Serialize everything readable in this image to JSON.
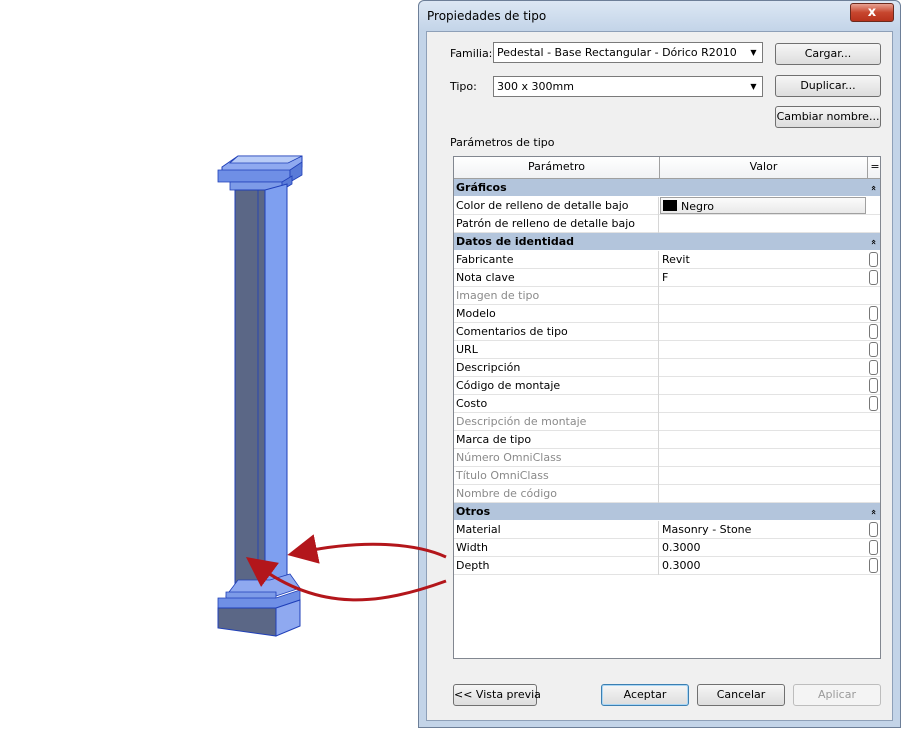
{
  "dialog": {
    "title": "Propiedades de tipo",
    "close_glyph": "x"
  },
  "family": {
    "label": "Familia:",
    "value": "Pedestal - Base Rectangular - Dórico R2010"
  },
  "type": {
    "label": "Tipo:",
    "value": "300 x 300mm"
  },
  "buttons": {
    "load": "Cargar...",
    "duplicate": "Duplicar...",
    "rename": "Cambiar nombre...",
    "preview": "<< Vista previa",
    "ok": "Aceptar",
    "cancel": "Cancelar",
    "apply": "Aplicar"
  },
  "grid": {
    "section_title": "Parámetros de tipo",
    "col_param": "Parámetro",
    "col_value": "Valor",
    "col_extra": "=",
    "collapse_glyph": "«",
    "groups": [
      {
        "name": "Gráficos",
        "rows": [
          {
            "param": "Color de relleno de detalle bajo",
            "value": "Negro",
            "kind": "color"
          },
          {
            "param": "Patrón de relleno de detalle bajo",
            "value": ""
          }
        ]
      },
      {
        "name": "Datos de identidad",
        "rows": [
          {
            "param": "Fabricante",
            "value": "Revit",
            "edit": true
          },
          {
            "param": "Nota clave",
            "value": "F",
            "edit": true
          },
          {
            "param": "Imagen de tipo",
            "value": "",
            "disabled": true
          },
          {
            "param": "Modelo",
            "value": "",
            "edit": true
          },
          {
            "param": "Comentarios de tipo",
            "value": "",
            "edit": true
          },
          {
            "param": "URL",
            "value": "",
            "edit": true
          },
          {
            "param": "Descripción",
            "value": "",
            "edit": true
          },
          {
            "param": "Código de montaje",
            "value": "",
            "edit": true
          },
          {
            "param": "Costo",
            "value": "",
            "edit": true
          },
          {
            "param": "Descripción de montaje",
            "value": "",
            "disabled": true
          },
          {
            "param": "Marca de tipo",
            "value": ""
          },
          {
            "param": "Número OmniClass",
            "value": "",
            "disabled": true
          },
          {
            "param": "Título OmniClass",
            "value": "",
            "disabled": true
          },
          {
            "param": "Nombre de código",
            "value": "",
            "disabled": true
          }
        ]
      },
      {
        "name": "Otros",
        "rows": [
          {
            "param": "Material",
            "value": "Masonry - Stone",
            "edit": true
          },
          {
            "param": "Width",
            "value": "0.3000",
            "edit": true
          },
          {
            "param": "Depth",
            "value": "0.3000",
            "edit": true
          }
        ]
      }
    ]
  },
  "colors": {
    "accent_blue": "#3c7fb1",
    "group_header": "#b3c5dc",
    "arrow_red": "#b3161b",
    "column_blue": "#5f84e0"
  }
}
